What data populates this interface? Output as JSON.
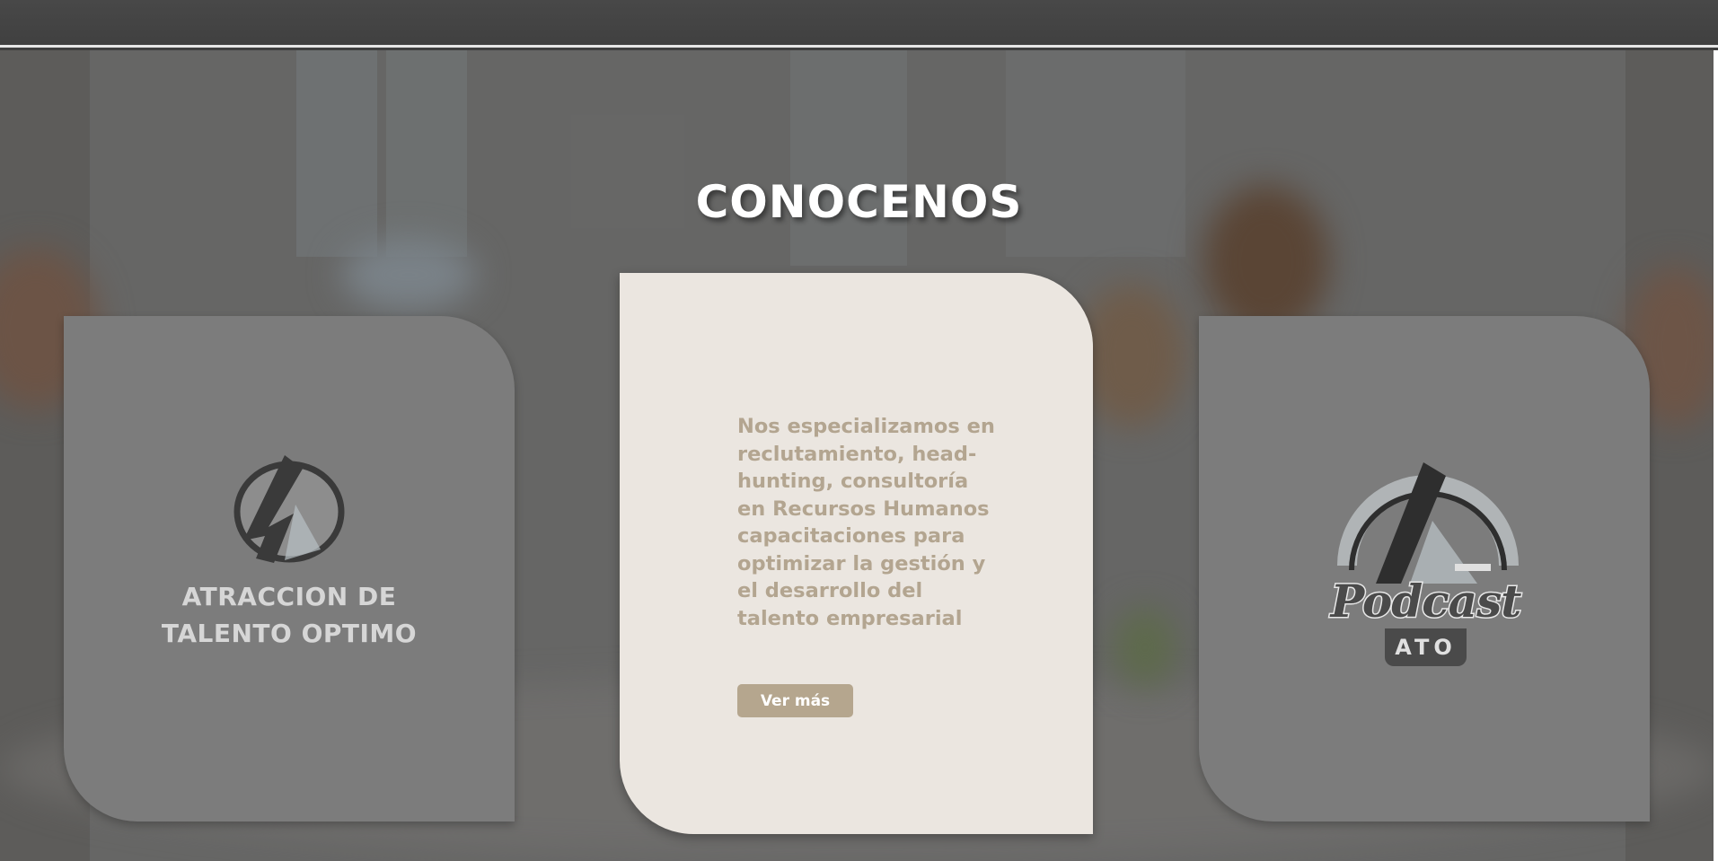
{
  "section": {
    "title": "CONOCENOS"
  },
  "card_left": {
    "logo_icon": "ato-logo-icon",
    "brand_line1": "ATRACCION DE",
    "brand_line2": "TALENTO OPTIMO"
  },
  "card_center": {
    "description": "Nos especializamos en reclutamiento, head-hunting, consultoría en Recursos Humanos capacitaciones para optimizar la gestión y el desarrollo del talento empresarial",
    "button_label": "Ver más"
  },
  "card_right": {
    "logo_icon": "podcast-ato-logo-icon",
    "podcast_word": "Podcast",
    "podcast_tag": "ATO"
  },
  "colors": {
    "topbar": "#444444",
    "card_side": "#7c7c7c",
    "card_center": "#ebe6e0",
    "accent_text": "#b3a590",
    "button": "#b5a68e"
  }
}
